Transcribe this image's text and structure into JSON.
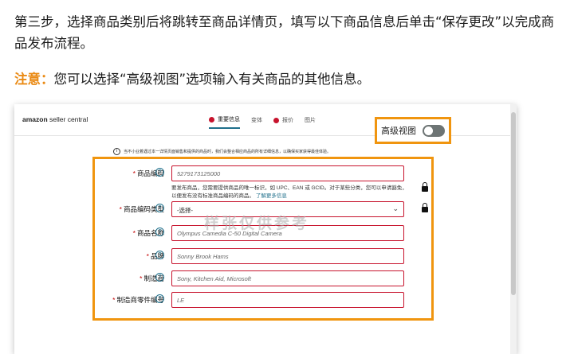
{
  "intro_text": "第三步，选择商品类别后将跳转至商品详情页，填写以下商品信息后单击“保存更改”以完成商品发布流程。",
  "note": {
    "label": "注意：",
    "text": "您可以选择“高级视图”选项输入有关商品的其他信息。"
  },
  "screenshot": {
    "brand_bold": "amazon",
    "brand_rest": " seller central",
    "tabs": [
      {
        "label": "重要信息",
        "active": true,
        "dot": true
      },
      {
        "label": "变体",
        "active": false,
        "dot": false
      },
      {
        "label": "报价",
        "active": false,
        "dot": true
      },
      {
        "label": "图片",
        "active": false,
        "dot": false
      }
    ],
    "advanced_view": {
      "label": "高级视图",
      "enabled": false
    },
    "info_text": "当不小业着遇过本一详情页面销售和提供的商品时，我们会整合相应商品的所有详细信息，以确保买家获得最佳体验。",
    "watermark": "样张仅供参考",
    "fields": [
      {
        "label": "商品编码",
        "value": "5279173125000",
        "required": true,
        "locked": true,
        "description": "要发布商品，您需要提供商品的唯一标识，如 UPC、EAN 或 GCID。对于某些分类，您可以申请豁免，以便发布没有标准商品编码的商品。",
        "link": "了解更多信息"
      },
      {
        "label": "商品编码类型",
        "value": "-选择-",
        "required": true,
        "locked": true,
        "select": true
      },
      {
        "label": "商品名称",
        "value": "Olympus Camedia C-50 Digital Camera",
        "required": true
      },
      {
        "label": "品牌",
        "value": "Sonny Brook Hams",
        "required": true
      },
      {
        "label": "制造商",
        "value": "Sony, Kitchen Aid, Microsoft",
        "required": true
      },
      {
        "label": "制造商零件编号",
        "value": "LE",
        "required": true
      }
    ]
  }
}
